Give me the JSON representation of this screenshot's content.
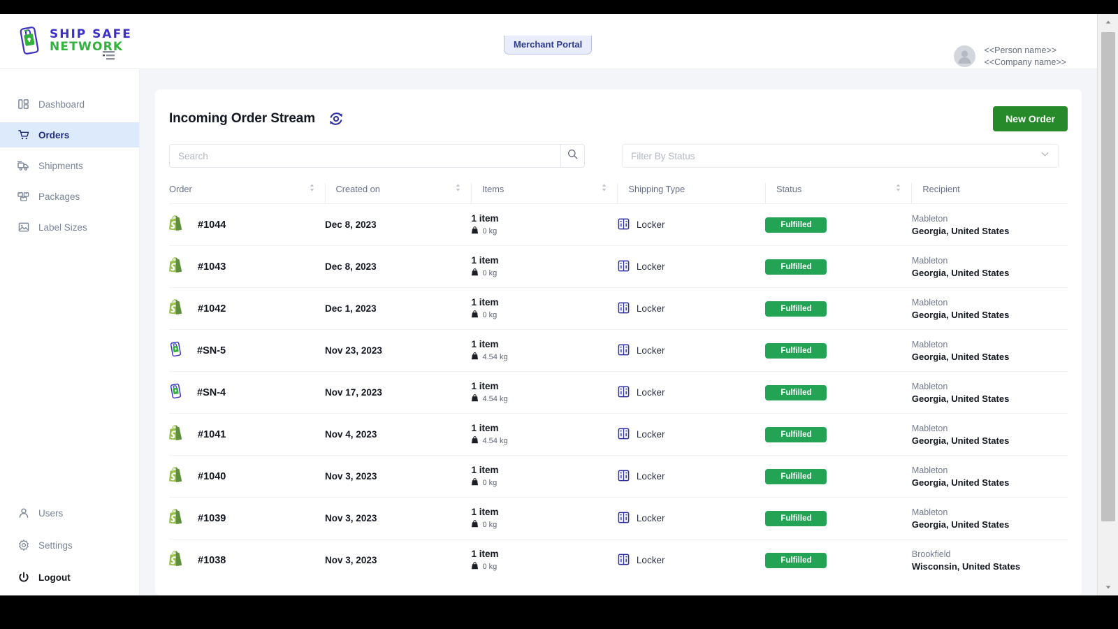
{
  "brand": {
    "logo_line1": "SHIP SAFE",
    "logo_line2": "NETWORK",
    "logo_blue": "#3b30c7",
    "logo_green": "#33b13f"
  },
  "topbar": {
    "portal_tab": "Merchant Portal",
    "person_name": "<<Person name>>",
    "company_name": "<<Company name>>"
  },
  "sidebar": {
    "primary": [
      {
        "label": "Dashboard",
        "icon": "dashboard-icon",
        "active": false
      },
      {
        "label": "Orders",
        "icon": "cart-icon",
        "active": true
      },
      {
        "label": "Shipments",
        "icon": "truck-icon",
        "active": false
      },
      {
        "label": "Packages",
        "icon": "boxes-icon",
        "active": false
      },
      {
        "label": "Label Sizes",
        "icon": "label-icon",
        "active": false
      }
    ],
    "secondary": [
      {
        "label": "Users",
        "icon": "user-icon"
      },
      {
        "label": "Settings",
        "icon": "gear-icon"
      },
      {
        "label": "Logout",
        "icon": "power-icon"
      }
    ]
  },
  "page": {
    "title": "Incoming Order Stream",
    "refresh_icon": "sync-icon",
    "new_order_label": "New Order",
    "accent_green": "#268a2a"
  },
  "search": {
    "placeholder": "Search",
    "value": "",
    "icon": "search-icon"
  },
  "status_filter": {
    "placeholder": "Filter By Status",
    "value": "",
    "icon": "chevron-down-icon"
  },
  "table": {
    "columns": [
      {
        "label": "Order",
        "sortable": true
      },
      {
        "label": "Created on",
        "sortable": true
      },
      {
        "label": "Items",
        "sortable": true
      },
      {
        "label": "Shipping Type",
        "sortable": false
      },
      {
        "label": "Status",
        "sortable": true
      },
      {
        "label": "Recipient",
        "sortable": false
      }
    ],
    "rows": [
      {
        "source_icon": "shopify-icon",
        "order": "#1044",
        "created_on": "Dec 8, 2023",
        "items": "1 item",
        "weight": "0 kg",
        "shipping_type": "Locker",
        "status": "Fulfilled",
        "city": "Mableton",
        "region": "Georgia, United States"
      },
      {
        "source_icon": "shopify-icon",
        "order": "#1043",
        "created_on": "Dec 8, 2023",
        "items": "1 item",
        "weight": "0 kg",
        "shipping_type": "Locker",
        "status": "Fulfilled",
        "city": "Mableton",
        "region": "Georgia, United States"
      },
      {
        "source_icon": "shopify-icon",
        "order": "#1042",
        "created_on": "Dec 1, 2023",
        "items": "1 item",
        "weight": "0 kg",
        "shipping_type": "Locker",
        "status": "Fulfilled",
        "city": "Mableton",
        "region": "Georgia, United States"
      },
      {
        "source_icon": "shipsafe-icon",
        "order": "#SN-5",
        "created_on": "Nov 23, 2023",
        "items": "1 item",
        "weight": "4.54 kg",
        "shipping_type": "Locker",
        "status": "Fulfilled",
        "city": "Mableton",
        "region": "Georgia, United States"
      },
      {
        "source_icon": "shipsafe-icon",
        "order": "#SN-4",
        "created_on": "Nov 17, 2023",
        "items": "1 item",
        "weight": "4.54 kg",
        "shipping_type": "Locker",
        "status": "Fulfilled",
        "city": "Mableton",
        "region": "Georgia, United States"
      },
      {
        "source_icon": "shopify-icon",
        "order": "#1041",
        "created_on": "Nov 4, 2023",
        "items": "1 item",
        "weight": "4.54 kg",
        "shipping_type": "Locker",
        "status": "Fulfilled",
        "city": "Mableton",
        "region": "Georgia, United States"
      },
      {
        "source_icon": "shopify-icon",
        "order": "#1040",
        "created_on": "Nov 3, 2023",
        "items": "1 item",
        "weight": "0 kg",
        "shipping_type": "Locker",
        "status": "Fulfilled",
        "city": "Mableton",
        "region": "Georgia, United States"
      },
      {
        "source_icon": "shopify-icon",
        "order": "#1039",
        "created_on": "Nov 3, 2023",
        "items": "1 item",
        "weight": "0 kg",
        "shipping_type": "Locker",
        "status": "Fulfilled",
        "city": "Mableton",
        "region": "Georgia, United States"
      },
      {
        "source_icon": "shopify-icon",
        "order": "#1038",
        "created_on": "Nov 3, 2023",
        "items": "1 item",
        "weight": "0 kg",
        "shipping_type": "Locker",
        "status": "Fulfilled",
        "city": "Brookfield",
        "region": "Wisconsin, United States"
      }
    ]
  }
}
